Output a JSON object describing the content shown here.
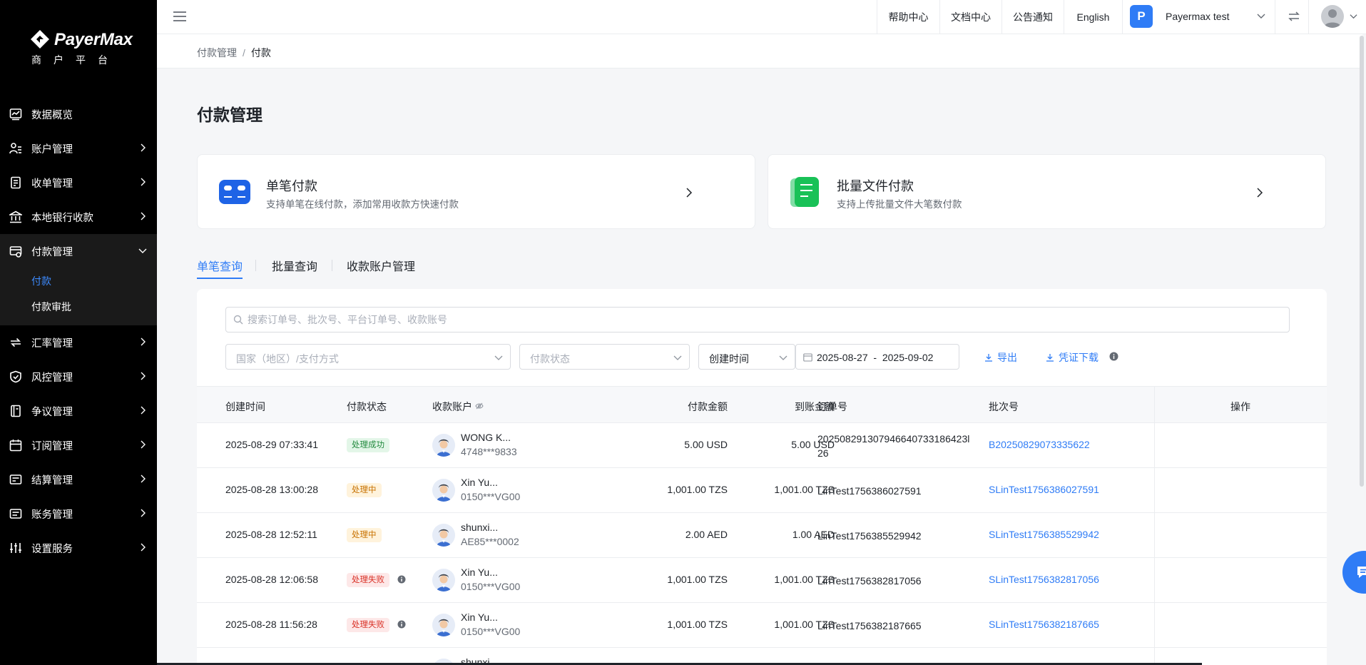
{
  "brand": {
    "name": "PayerMax",
    "subtitle": "商户平台"
  },
  "sidebar": {
    "items": [
      {
        "label": "数据概览",
        "icon": "chart-icon"
      },
      {
        "label": "账户管理",
        "icon": "user-group-icon"
      },
      {
        "label": "收单管理",
        "icon": "receipt-icon"
      },
      {
        "label": "本地银行收款",
        "icon": "bank-icon"
      },
      {
        "label": "付款管理",
        "icon": "payment-icon"
      },
      {
        "label": "汇率管理",
        "icon": "exchange-icon"
      },
      {
        "label": "风控管理",
        "icon": "shield-icon"
      },
      {
        "label": "争议管理",
        "icon": "dispute-icon"
      },
      {
        "label": "订阅管理",
        "icon": "calendar-icon"
      },
      {
        "label": "结算管理",
        "icon": "settlement-icon"
      },
      {
        "label": "账务管理",
        "icon": "ledger-icon"
      },
      {
        "label": "设置服务",
        "icon": "sliders-icon"
      }
    ],
    "sub_items": [
      "付款",
      "付款审批"
    ]
  },
  "topbar": {
    "links": [
      "帮助中心",
      "文档中心",
      "公告通知",
      "English"
    ],
    "merchant_initial": "P",
    "merchant_name": "Payermax test"
  },
  "breadcrumb": {
    "parent": "付款管理",
    "separator": "/",
    "current": "付款"
  },
  "page_title": "付款管理",
  "cards": [
    {
      "title": "单笔付款",
      "desc": "支持单笔在线付款，添加常用收款方快速付款"
    },
    {
      "title": "批量文件付款",
      "desc": "支持上传批量文件大笔数付款"
    }
  ],
  "tabs": [
    "单笔查询",
    "批量查询",
    "收款账户管理"
  ],
  "filters": {
    "search_placeholder": "搜索订单号、批次号、平台订单号、收款账号",
    "country_placeholder": "国家（地区）/支付方式",
    "status_placeholder": "付款状态",
    "time_type": "创建时间",
    "date_start": "2025-08-27",
    "date_sep": "-",
    "date_end": "2025-09-02",
    "export_label": "导出",
    "voucher_label": "凭证下载"
  },
  "table": {
    "headers": [
      "创建时间",
      "付款状态",
      "收款账户",
      "付款金额",
      "到账金额",
      "订单号",
      "批次号",
      "操作"
    ],
    "rows": [
      {
        "time": "2025-08-29 07:33:41",
        "status": "处理成功",
        "status_type": "success",
        "acc_name": "WONG K...",
        "acc_no": "4748***9833",
        "pay": "5.00 USD",
        "recv": "5.00 USD",
        "order_l1": "202508291307946640733186423l",
        "order_l2": "26",
        "batch": "B20250829073335622"
      },
      {
        "time": "2025-08-28 13:00:28",
        "status": "处理中",
        "status_type": "pending",
        "acc_name": "Xin Yu...",
        "acc_no": "0150***VG00",
        "pay": "1,001.00 TZS",
        "recv": "1,001.00 TZS",
        "order_l1": "LinTest1756386027591",
        "order_l2": "",
        "batch": "SLinTest1756386027591"
      },
      {
        "time": "2025-08-28 12:52:11",
        "status": "处理中",
        "status_type": "pending",
        "acc_name": "shunxi...",
        "acc_no": "AE85***0002",
        "pay": "2.00 AED",
        "recv": "1.00 AED",
        "order_l1": "LinTest1756385529942",
        "order_l2": "",
        "batch": "SLinTest1756385529942"
      },
      {
        "time": "2025-08-28 12:06:58",
        "status": "处理失败",
        "status_type": "fail",
        "acc_name": "Xin Yu...",
        "acc_no": "0150***VG00",
        "pay": "1,001.00 TZS",
        "recv": "1,001.00 TZS",
        "order_l1": "LinTest1756382817056",
        "order_l2": "",
        "batch": "SLinTest1756382817056"
      },
      {
        "time": "2025-08-28 11:56:28",
        "status": "处理失败",
        "status_type": "fail",
        "acc_name": "Xin Yu...",
        "acc_no": "0150***VG00",
        "pay": "1,001.00 TZS",
        "recv": "1,001.00 TZS",
        "order_l1": "LinTest1756382187665",
        "order_l2": "",
        "batch": "SLinTest1756382187665"
      },
      {
        "time": "",
        "status": "",
        "status_type": "pending",
        "acc_name": "shunxi...",
        "acc_no": "",
        "pay": "",
        "recv": "",
        "order_l1": "",
        "order_l2": "",
        "batch": ""
      }
    ]
  },
  "colors": {
    "accent": "#2f7cf6",
    "sidebar_bg": "#000000",
    "success": "#228a3e",
    "pending": "#c77100",
    "fail": "#d93025"
  }
}
